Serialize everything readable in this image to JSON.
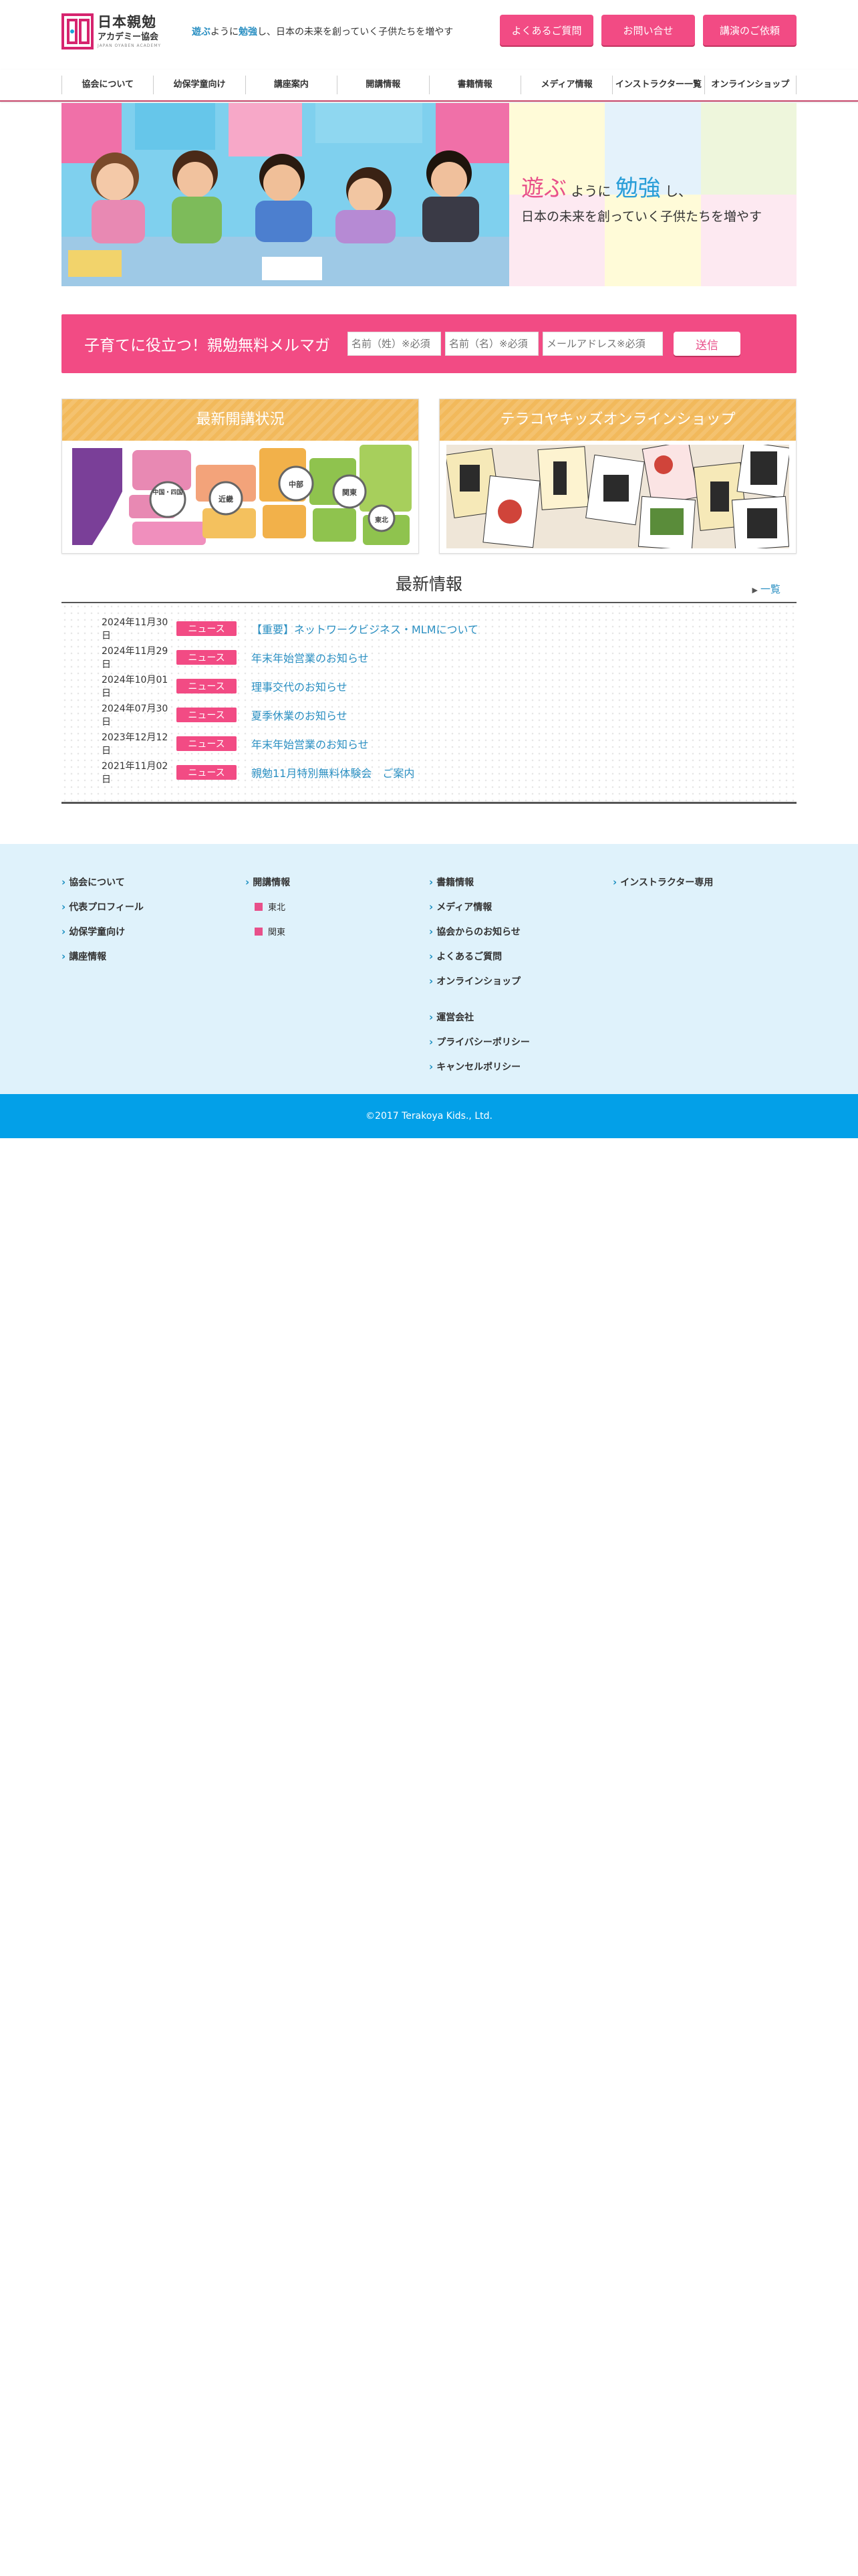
{
  "header": {
    "logo": {
      "line1": "日本親勉",
      "line2": "アカデミー協会",
      "line3": "JAPAN OYABEN ACADEMY"
    },
    "tagline": {
      "hl1": "遊ぶ",
      "t1": "ように",
      "hl2": "勉強",
      "t2": "し、日本の未来を創っていく子供たちを増やす"
    },
    "buttons": [
      "よくあるご質問",
      "お問い合せ",
      "講演のご依頼"
    ]
  },
  "nav": [
    "協会について",
    "幼保学童向け",
    "講座案内",
    "開講情報",
    "書籍情報",
    "メディア情報",
    "インストラクター一覧",
    "オンラインショップ"
  ],
  "hero": {
    "w1": "遊ぶ",
    "w2": "ように",
    "w3": "勉強",
    "w4": "し、",
    "line2": "日本の未来を創っていく子供たちを増やす"
  },
  "mailmag": {
    "title": "子育てに役立つ！親勉無料メルマガ",
    "placeholders": [
      "名前（姓）※必須",
      "名前（名）※必須",
      "メールアドレス※必須"
    ],
    "send": "送信"
  },
  "boxes": {
    "status": {
      "title": "最新開講状況",
      "regions": [
        "中国・四国",
        "近畿",
        "中部",
        "関東",
        "東北"
      ]
    },
    "shop": {
      "title": "テラコヤキッズオンラインショップ"
    }
  },
  "news": {
    "title": "最新情報",
    "more": "一覧",
    "items": [
      {
        "date": "2024年11月30日",
        "tag": "ニュース",
        "title": "【重要】ネットワークビジネス・MLMについて"
      },
      {
        "date": "2024年11月29日",
        "tag": "ニュース",
        "title": "年末年始営業のお知らせ"
      },
      {
        "date": "2024年10月01日",
        "tag": "ニュース",
        "title": "理事交代のお知らせ"
      },
      {
        "date": "2024年07月30日",
        "tag": "ニュース",
        "title": "夏季休業のお知らせ"
      },
      {
        "date": "2023年12月12日",
        "tag": "ニュース",
        "title": "年末年始営業のお知らせ"
      },
      {
        "date": "2021年11月02日",
        "tag": "ニュース",
        "title": "親勉11月特別無料体験会　ご案内"
      }
    ]
  },
  "footer": {
    "col1": [
      "協会について",
      "代表プロフィール",
      "幼保学童向け",
      "講座情報"
    ],
    "col2": {
      "head": "開講情報",
      "subs": [
        "東北",
        "関東"
      ]
    },
    "col3a": [
      "書籍情報",
      "メディア情報",
      "協会からのお知らせ",
      "よくあるご質問",
      "オンラインショップ"
    ],
    "col3b": [
      "運営会社",
      "プライバシーポリシー",
      "キャンセルポリシー"
    ],
    "col4": [
      "インストラクター専用"
    ],
    "copyright": "©2017 Terakoya Kids., Ltd."
  },
  "colors": {
    "pink": "#f24b84",
    "blue": "#2a8fc2",
    "gold": "#f2b95b",
    "footer_bg": "#dff2fb",
    "copyright_bg": "#03a0e8"
  }
}
